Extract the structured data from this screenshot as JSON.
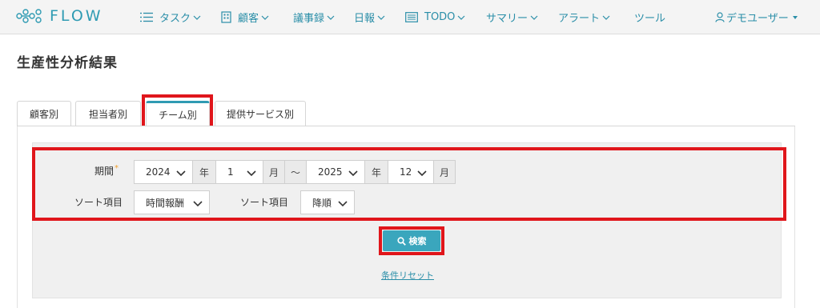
{
  "app": {
    "logo_text": "FLOW"
  },
  "nav": {
    "items": [
      {
        "label": "タスク",
        "icon": "list-icon"
      },
      {
        "label": "顧客",
        "icon": "building-icon"
      },
      {
        "label": "議事録"
      },
      {
        "label": "日報"
      },
      {
        "label": "TODO",
        "icon": "table-icon"
      },
      {
        "label": "サマリー"
      },
      {
        "label": "アラート"
      },
      {
        "label": "ツール"
      }
    ],
    "user": "デモユーザー"
  },
  "page": {
    "title": "生産性分析結果"
  },
  "tabs": [
    {
      "label": "顧客別"
    },
    {
      "label": "担当者別"
    },
    {
      "label": "チーム別",
      "active": true
    },
    {
      "label": "提供サービス別"
    }
  ],
  "form": {
    "period_label": "期間",
    "required_mark": "*",
    "start_year": "2024",
    "year_unit": "年",
    "start_month": "1",
    "month_unit": "月",
    "tilde": "〜",
    "end_year": "2025",
    "end_month": "12",
    "sort1_label": "ソート項目",
    "sort1_value": "時間報酬",
    "sort2_label": "ソート項目",
    "sort2_value": "降順"
  },
  "actions": {
    "search_label": "検索",
    "reset_label": "条件リセット"
  },
  "colors": {
    "accent": "#2f9bb3",
    "highlight": "#e0161b",
    "button": "#3aa6bd"
  }
}
